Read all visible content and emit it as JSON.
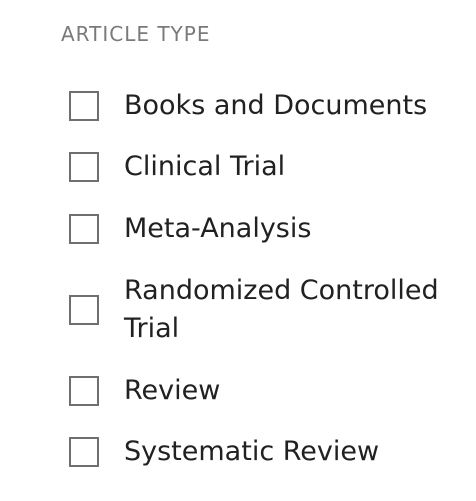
{
  "article_type": {
    "heading": "ARTICLE TYPE",
    "options": [
      {
        "label": "Books and Documents",
        "checked": false
      },
      {
        "label": "Clinical Trial",
        "checked": false
      },
      {
        "label": "Meta-Analysis",
        "checked": false
      },
      {
        "label": "Randomized Controlled Trial",
        "checked": false
      },
      {
        "label": "Review",
        "checked": false
      },
      {
        "label": "Systematic Review",
        "checked": false
      }
    ]
  },
  "colors": {
    "heading": "#7a7a7a",
    "label": "#212121",
    "checkbox_border": "#6f6f6f"
  }
}
